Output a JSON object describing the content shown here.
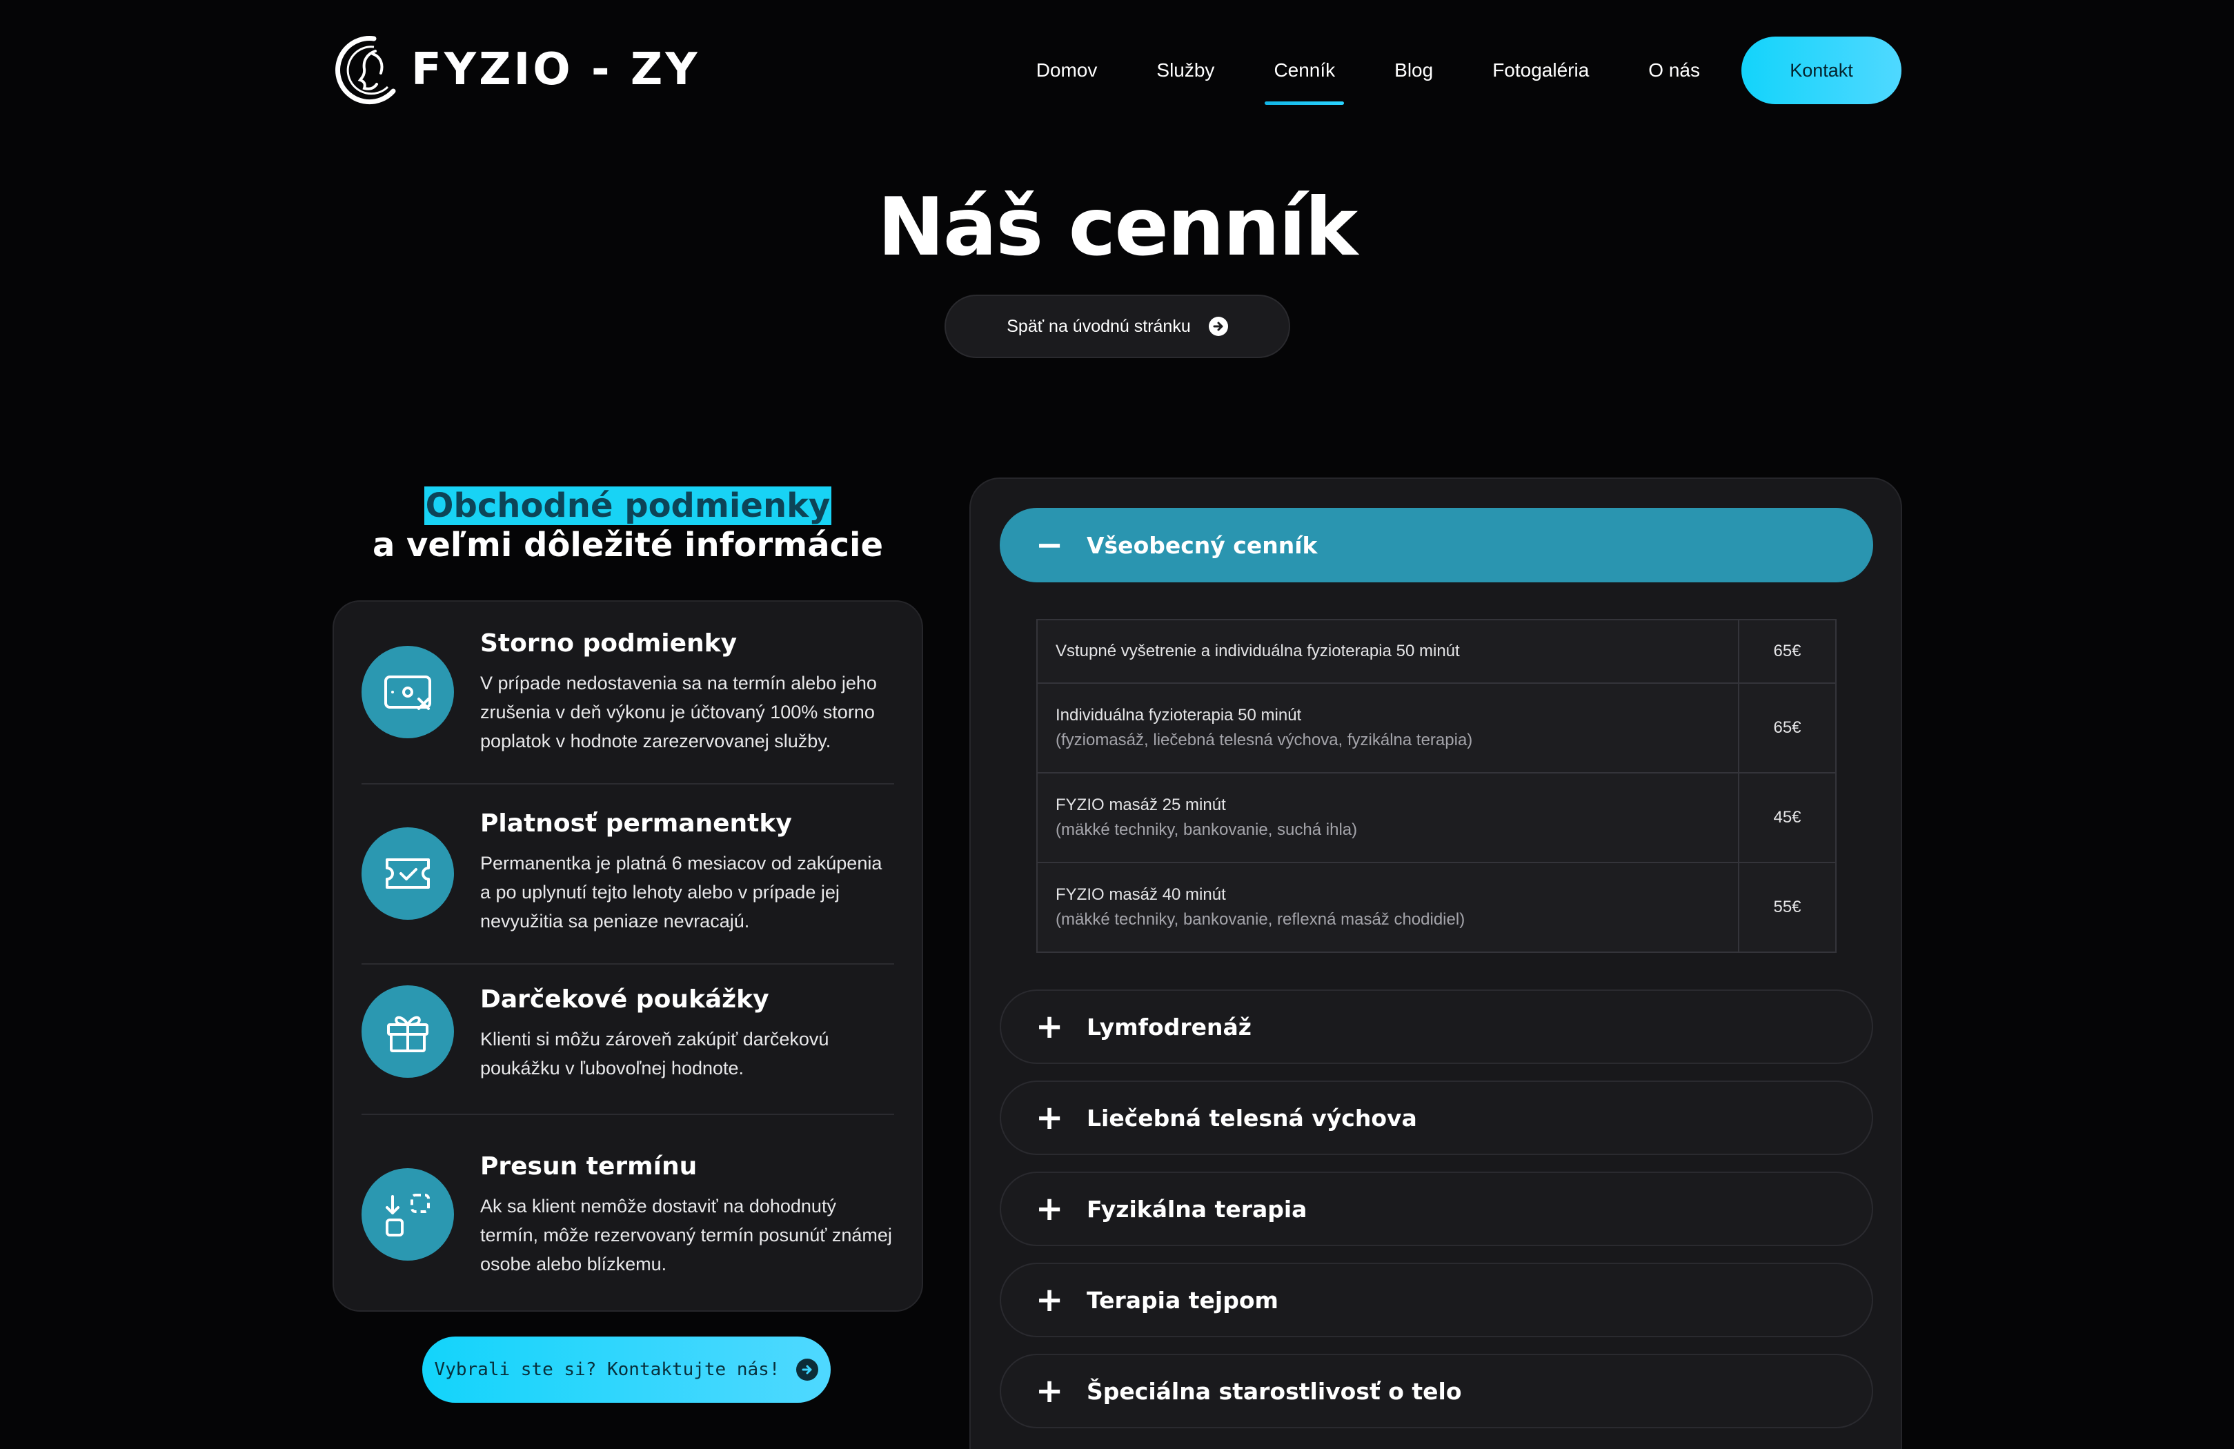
{
  "header": {
    "logo_text": "FYZIO - ZY",
    "nav": [
      {
        "label": "Domov",
        "active": false
      },
      {
        "label": "Služby",
        "active": false
      },
      {
        "label": "Cenník",
        "active": true
      },
      {
        "label": "Blog",
        "active": false
      },
      {
        "label": "Fotogaléria",
        "active": false
      },
      {
        "label": "O nás",
        "active": false
      }
    ],
    "cta_label": "Kontakt"
  },
  "hero": {
    "title": "Náš cenník",
    "back_button": "Späť na úvodnú stránku"
  },
  "conditions": {
    "highlight": "Obchodné podmienky",
    "subtitle": "a veľmi dôležité informácie",
    "items": [
      {
        "icon": "ticket-cancel-icon",
        "title": "Storno podmienky",
        "text": "V prípade nedostavenia sa na termín alebo jeho zrušenia v deň výkonu je účtovaný 100% storno poplatok v hodnote zarezervovanej služby."
      },
      {
        "icon": "ticket-check-icon",
        "title": "Platnosť permanentky",
        "text": "Permanentka je platná 6 mesiacov od zakúpenia a po uplynutí tejto lehoty alebo v prípade jej nevyužitia sa peniaze nevracajú."
      },
      {
        "icon": "gift-icon",
        "title": "Darčekové poukážky",
        "text": "Klienti si môžu zároveň zakúpiť darčekovú poukážku v ľubovoľnej hodnote."
      },
      {
        "icon": "transfer-icon",
        "title": "Presun termínu",
        "text": "Ak sa klient nemôže dostaviť na dohodnutý termín, môže rezervovaný termín posunúť známej osobe alebo blízkemu."
      }
    ],
    "cta": "Vybrali ste si? Kontaktujte nás!"
  },
  "pricing": {
    "open_sign": "−",
    "closed_sign": "+",
    "open_section": "Všeobecný cenník",
    "rows": [
      {
        "service": "Vstupné vyšetrenie a individuálna fyzioterapia 50 minút",
        "note": "",
        "price": "65€"
      },
      {
        "service": "Individuálna fyzioterapia 50 minút",
        "note": "(fyziomasáž, liečebná telesná výchova, fyzikálna terapia)",
        "price": "65€"
      },
      {
        "service": "FYZIO masáž 25 minút",
        "note": "(mäkké techniky, bankovanie, suchá ihla)",
        "price": "45€"
      },
      {
        "service": "FYZIO masáž 40 minút",
        "note": "(mäkké techniky, bankovanie, reflexná masáž chodidiel)",
        "price": "55€"
      }
    ],
    "closed_sections": [
      "Lymfodrenáž",
      "Liečebná telesná výchova",
      "Fyzikálna terapia",
      "Terapia tejpom",
      "Špeciálna starostlivosť o telo"
    ]
  }
}
